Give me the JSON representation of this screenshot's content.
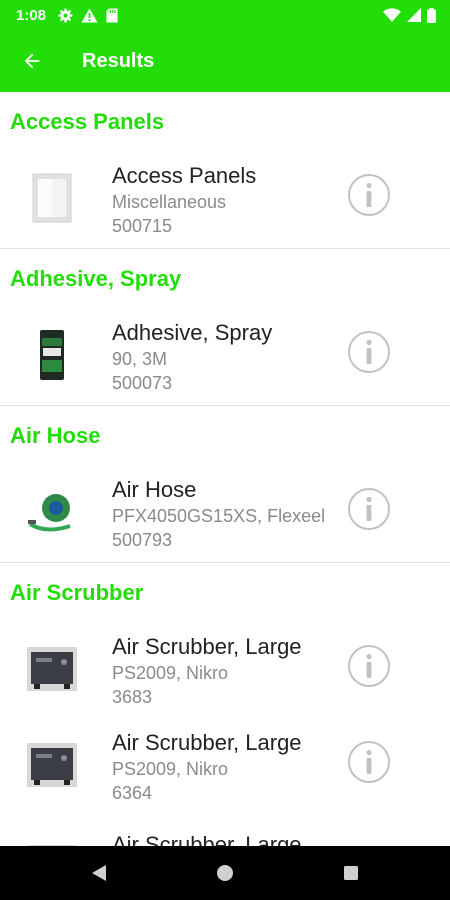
{
  "status": {
    "time": "1:08",
    "left_icons": [
      "gear-icon",
      "alert-icon",
      "sd-card-icon"
    ],
    "right_icons": [
      "wifi-icon",
      "cell-signal-icon",
      "battery-icon"
    ]
  },
  "app_bar": {
    "title": "Results",
    "back_icon": "arrow-back-icon"
  },
  "sections": [
    {
      "header": "Access Panels",
      "items": [
        {
          "title": "Access Panels",
          "subtitle": "Miscellaneous",
          "code": "500715",
          "thumb": "access-panel-image"
        }
      ]
    },
    {
      "header": "Adhesive, Spray",
      "items": [
        {
          "title": "Adhesive, Spray",
          "subtitle": "90, 3M",
          "code": "500073",
          "thumb": "spray-can-image"
        }
      ]
    },
    {
      "header": "Air Hose",
      "items": [
        {
          "title": "Air Hose",
          "subtitle": "PFX4050GS15XS, Flexeel",
          "code": "500793",
          "thumb": "air-hose-image"
        }
      ]
    },
    {
      "header": "Air Scrubber",
      "items": [
        {
          "title": "Air Scrubber, Large",
          "subtitle": "PS2009, Nikro",
          "code": "3683",
          "thumb": "air-scrubber-image"
        },
        {
          "title": "Air Scrubber, Large",
          "subtitle": "PS2009, Nikro",
          "code": "6364",
          "thumb": "air-scrubber-image"
        },
        {
          "title": "Air Scrubber, Large",
          "subtitle": "",
          "code": "",
          "thumb": "air-scrubber-image"
        }
      ]
    }
  ],
  "nav": {
    "back": "nav-back-icon",
    "home": "nav-home-icon",
    "recents": "nav-recents-icon"
  },
  "colors": {
    "accent": "#22dd08",
    "info_ring": "#c2c2c2",
    "subtext": "#8a8a8a"
  }
}
